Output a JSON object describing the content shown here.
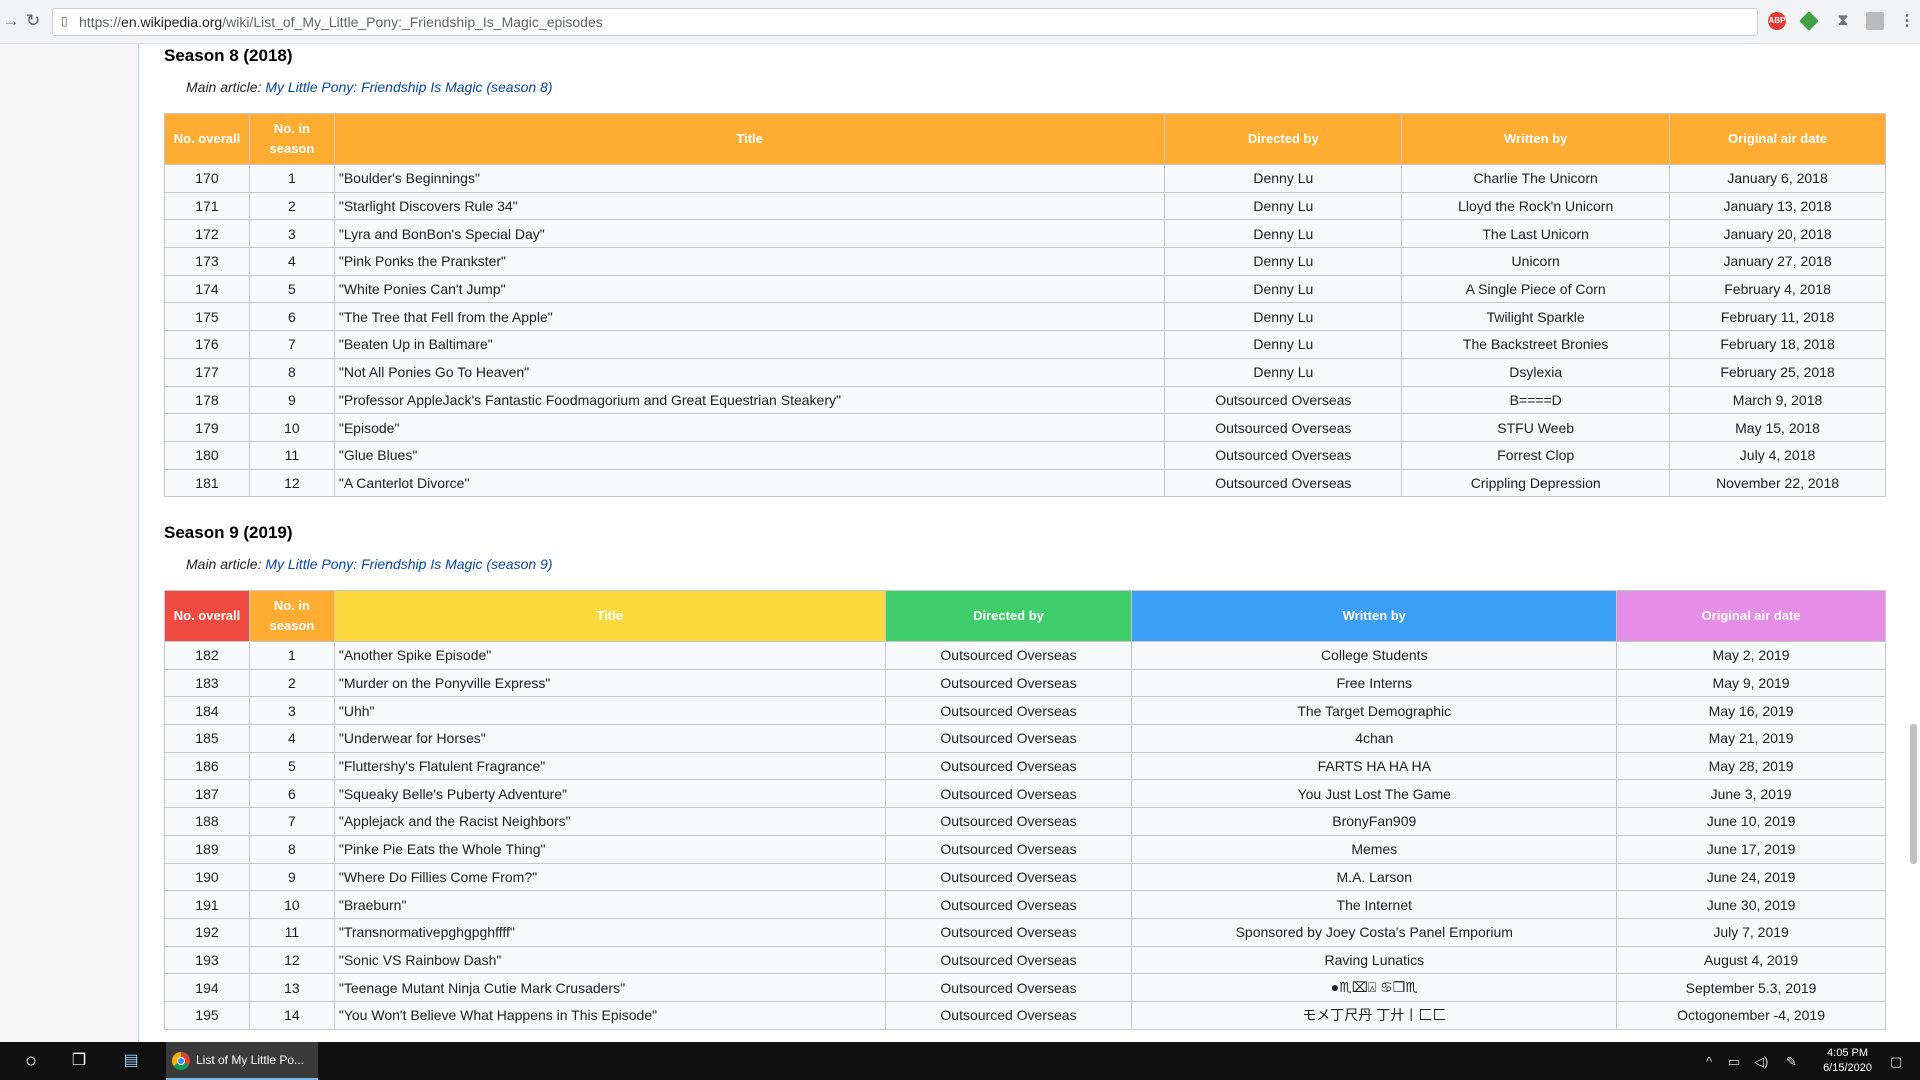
{
  "browser": {
    "url_prefix": "https://",
    "url_domain": "en.wikipedia.org",
    "url_path": "/wiki/List_of_My_Little_Pony:_Friendship_Is_Magic_episodes"
  },
  "season8": {
    "heading": "Season 8 (2018)",
    "hatnote_prefix": "Main article: ",
    "hatnote_link": "My Little Pony: Friendship Is Magic (season 8)",
    "headers": [
      "No. overall",
      "No. in season",
      "Title",
      "Directed by",
      "Written by",
      "Original air date"
    ],
    "header_color": "#ffac33",
    "rows": [
      [
        "170",
        "1",
        "\"Boulder's Beginnings\"",
        "Denny Lu",
        "Charlie The Unicorn",
        "January 6, 2018"
      ],
      [
        "171",
        "2",
        "\"Starlight Discovers Rule 34\"",
        "Denny Lu",
        "Lloyd the Rock'n Unicorn",
        "January 13, 2018"
      ],
      [
        "172",
        "3",
        "\"Lyra and BonBon's Special Day\"",
        "Denny Lu",
        "The Last Unicorn",
        "January 20, 2018"
      ],
      [
        "173",
        "4",
        "\"Pink Ponks the Prankster\"",
        "Denny Lu",
        "Unicorn",
        "January 27, 2018"
      ],
      [
        "174",
        "5",
        "\"White Ponies Can't Jump\"",
        "Denny Lu",
        "A Single Piece of Corn",
        "February 4, 2018"
      ],
      [
        "175",
        "6",
        "\"The Tree that Fell from the Apple\"",
        "Denny Lu",
        "Twilight Sparkle",
        "February 11, 2018"
      ],
      [
        "176",
        "7",
        "\"Beaten Up in Baltimare\"",
        "Denny Lu",
        "The Backstreet Bronies",
        "February 18, 2018"
      ],
      [
        "177",
        "8",
        "\"Not All Ponies Go To Heaven\"",
        "Denny Lu",
        "Dsylexia",
        "February 25, 2018"
      ],
      [
        "178",
        "9",
        "\"Professor AppleJack's Fantastic Foodmagorium and Great Equestrian Steakery\"",
        "Outsourced Overseas",
        "B====D",
        "March 9, 2018"
      ],
      [
        "179",
        "10",
        "\"Episode\"",
        "Outsourced Overseas",
        "STFU Weeb",
        "May 15, 2018"
      ],
      [
        "180",
        "11",
        "\"Glue Blues\"",
        "Outsourced Overseas",
        "Forrest Clop",
        "July 4, 2018"
      ],
      [
        "181",
        "12",
        "\"A Canterlot Divorce\"",
        "Outsourced Overseas",
        "Crippling Depression",
        "November 22, 2018"
      ]
    ]
  },
  "season9": {
    "heading": "Season 9 (2019)",
    "hatnote_prefix": "Main article: ",
    "hatnote_link": "My Little Pony: Friendship Is Magic (season 9)",
    "headers": [
      "No. overall",
      "No. in season",
      "Title",
      "Directed by",
      "Written by",
      "Original air date"
    ],
    "header_colors": [
      "#f04b40",
      "#ffac33",
      "#f9d93c",
      "#3fcd6b",
      "#3b9ff6",
      "#e58ee8"
    ],
    "rows": [
      [
        "182",
        "1",
        "\"Another Spike Episode\"",
        "Outsourced Overseas",
        "College Students",
        "May 2, 2019"
      ],
      [
        "183",
        "2",
        "\"Murder on the Ponyville Express\"",
        "Outsourced Overseas",
        "Free Interns",
        "May 9, 2019"
      ],
      [
        "184",
        "3",
        "\"Uhh\"",
        "Outsourced Overseas",
        "The Target Demographic",
        "May 16, 2019"
      ],
      [
        "185",
        "4",
        "\"Underwear for Horses\"",
        "Outsourced Overseas",
        "4chan",
        "May 21, 2019"
      ],
      [
        "186",
        "5",
        "\"Fluttershy's Flatulent Fragrance\"",
        "Outsourced Overseas",
        "FARTS HA HA HA",
        "May 28, 2019"
      ],
      [
        "187",
        "6",
        "\"Squeaky Belle's Puberty Adventure\"",
        "Outsourced Overseas",
        "You Just Lost The Game",
        "June 3, 2019"
      ],
      [
        "188",
        "7",
        "\"Applejack and the Racist Neighbors\"",
        "Outsourced Overseas",
        "BronyFan909",
        "June 10, 2019"
      ],
      [
        "189",
        "8",
        "\"Pinke Pie Eats the Whole Thing\"",
        "Outsourced Overseas",
        "Memes",
        "June 17, 2019"
      ],
      [
        "190",
        "9",
        "\"Where Do Fillies Come From?\"",
        "Outsourced Overseas",
        "M.A. Larson",
        "June 24, 2019"
      ],
      [
        "191",
        "10",
        "\"Braeburn\"",
        "Outsourced Overseas",
        "The Internet",
        "June 30, 2019"
      ],
      [
        "192",
        "11",
        "\"Transnormativepghgpghffff\"",
        "Outsourced Overseas",
        "Sponsored by Joey Costa's Panel Emporium",
        "July 7, 2019"
      ],
      [
        "193",
        "12",
        "\"Sonic VS Rainbow Dash\"",
        "Outsourced Overseas",
        "Raving Lunatics",
        "August 4, 2019"
      ],
      [
        "194",
        "13",
        "\"Teenage Mutant Ninja Cutie Mark Crusaders\"",
        "Outsourced Overseas",
        "●♏︎⌧︎⍓︎ ♋︎❒︎♏︎",
        "September 5.3, 2019"
      ],
      [
        "195",
        "14",
        "\"You Won't Believe What Happens in This Episode\"",
        "Outsourced Overseas",
        "モメ丁尺丹 丁廾丨匚匚",
        "Octogonember -4, 2019"
      ]
    ]
  },
  "taskbar": {
    "app_label": "List of My Little Po...",
    "time": "4:05 PM",
    "date": "6/15/2020"
  }
}
